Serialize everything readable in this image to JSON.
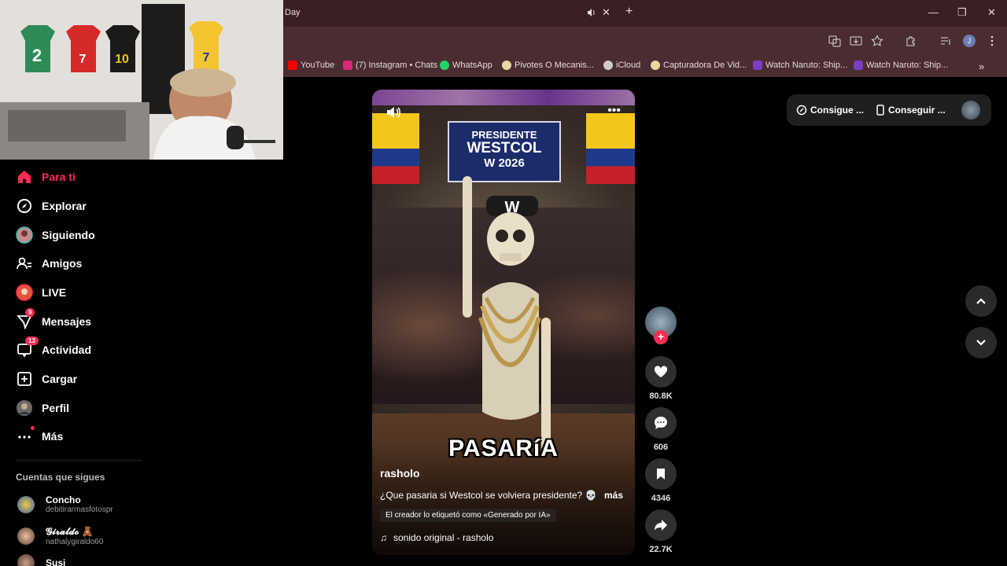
{
  "browser": {
    "tab_title": "Day",
    "bookmarks": [
      {
        "label": "YouTube",
        "color": "#ff0000"
      },
      {
        "label": "(7) Instagram • Chats",
        "color": "#d62976"
      },
      {
        "label": "WhatsApp",
        "color": "#25d366"
      },
      {
        "label": "Pivotes O Mecanis...",
        "color": "#e8d9a0"
      },
      {
        "label": "iCloud",
        "color": "#cccccc"
      },
      {
        "label": "Capturadora De Vid...",
        "color": "#e8d9a0"
      },
      {
        "label": "Watch Naruto: Ship...",
        "color": "#7b3fbf"
      },
      {
        "label": "Watch Naruto: Ship...",
        "color": "#7b3fbf"
      }
    ]
  },
  "sidebar": {
    "items": [
      {
        "label": "Para ti",
        "icon": "home-icon",
        "active": true
      },
      {
        "label": "Explorar",
        "icon": "compass-icon"
      },
      {
        "label": "Siguiendo",
        "icon": "following-avatar-icon"
      },
      {
        "label": "Amigos",
        "icon": "friends-icon"
      },
      {
        "label": "LIVE",
        "icon": "live-avatar-icon"
      },
      {
        "label": "Mensajes",
        "icon": "messages-icon",
        "badge": "9"
      },
      {
        "label": "Actividad",
        "icon": "activity-icon",
        "badge": "13"
      },
      {
        "label": "Cargar",
        "icon": "upload-icon"
      },
      {
        "label": "Perfil",
        "icon": "profile-avatar-icon"
      },
      {
        "label": "Más",
        "icon": "more-icon"
      }
    ],
    "following_title": "Cuentas que sigues",
    "following": [
      {
        "name": "Concho",
        "handle": "debitirarmasfotospr"
      },
      {
        "name": "𝓖𝓲𝓻𝓪𝓵𝓭𝓸 🧸",
        "handle": "nathalygiraldo60"
      },
      {
        "name": "Susi",
        "handle": ""
      }
    ]
  },
  "video": {
    "banner_line1": "PRESIDENTE",
    "banner_line2": "WESTCOL",
    "banner_line3": "W 2026",
    "cap_letter": "W",
    "overlay_text": "PASARíA",
    "author": "rasholo",
    "caption": "¿Que pasaria si Westcol se volviera presidente? 💀",
    "more_label": "más",
    "ai_label": "El creador lo etiquetó como «Generado por IA»",
    "sound": "sonido original - rasholo"
  },
  "actions": {
    "likes": "80.8K",
    "comments": "606",
    "saves": "4346",
    "shares": "22.7K"
  },
  "top_right": {
    "item1": "Consigue ...",
    "item2": "Conseguir ..."
  },
  "colors": {
    "accent": "#fe2c55",
    "tab_bg": "#3a1f24",
    "toolbar_bg": "#4a2c31"
  }
}
